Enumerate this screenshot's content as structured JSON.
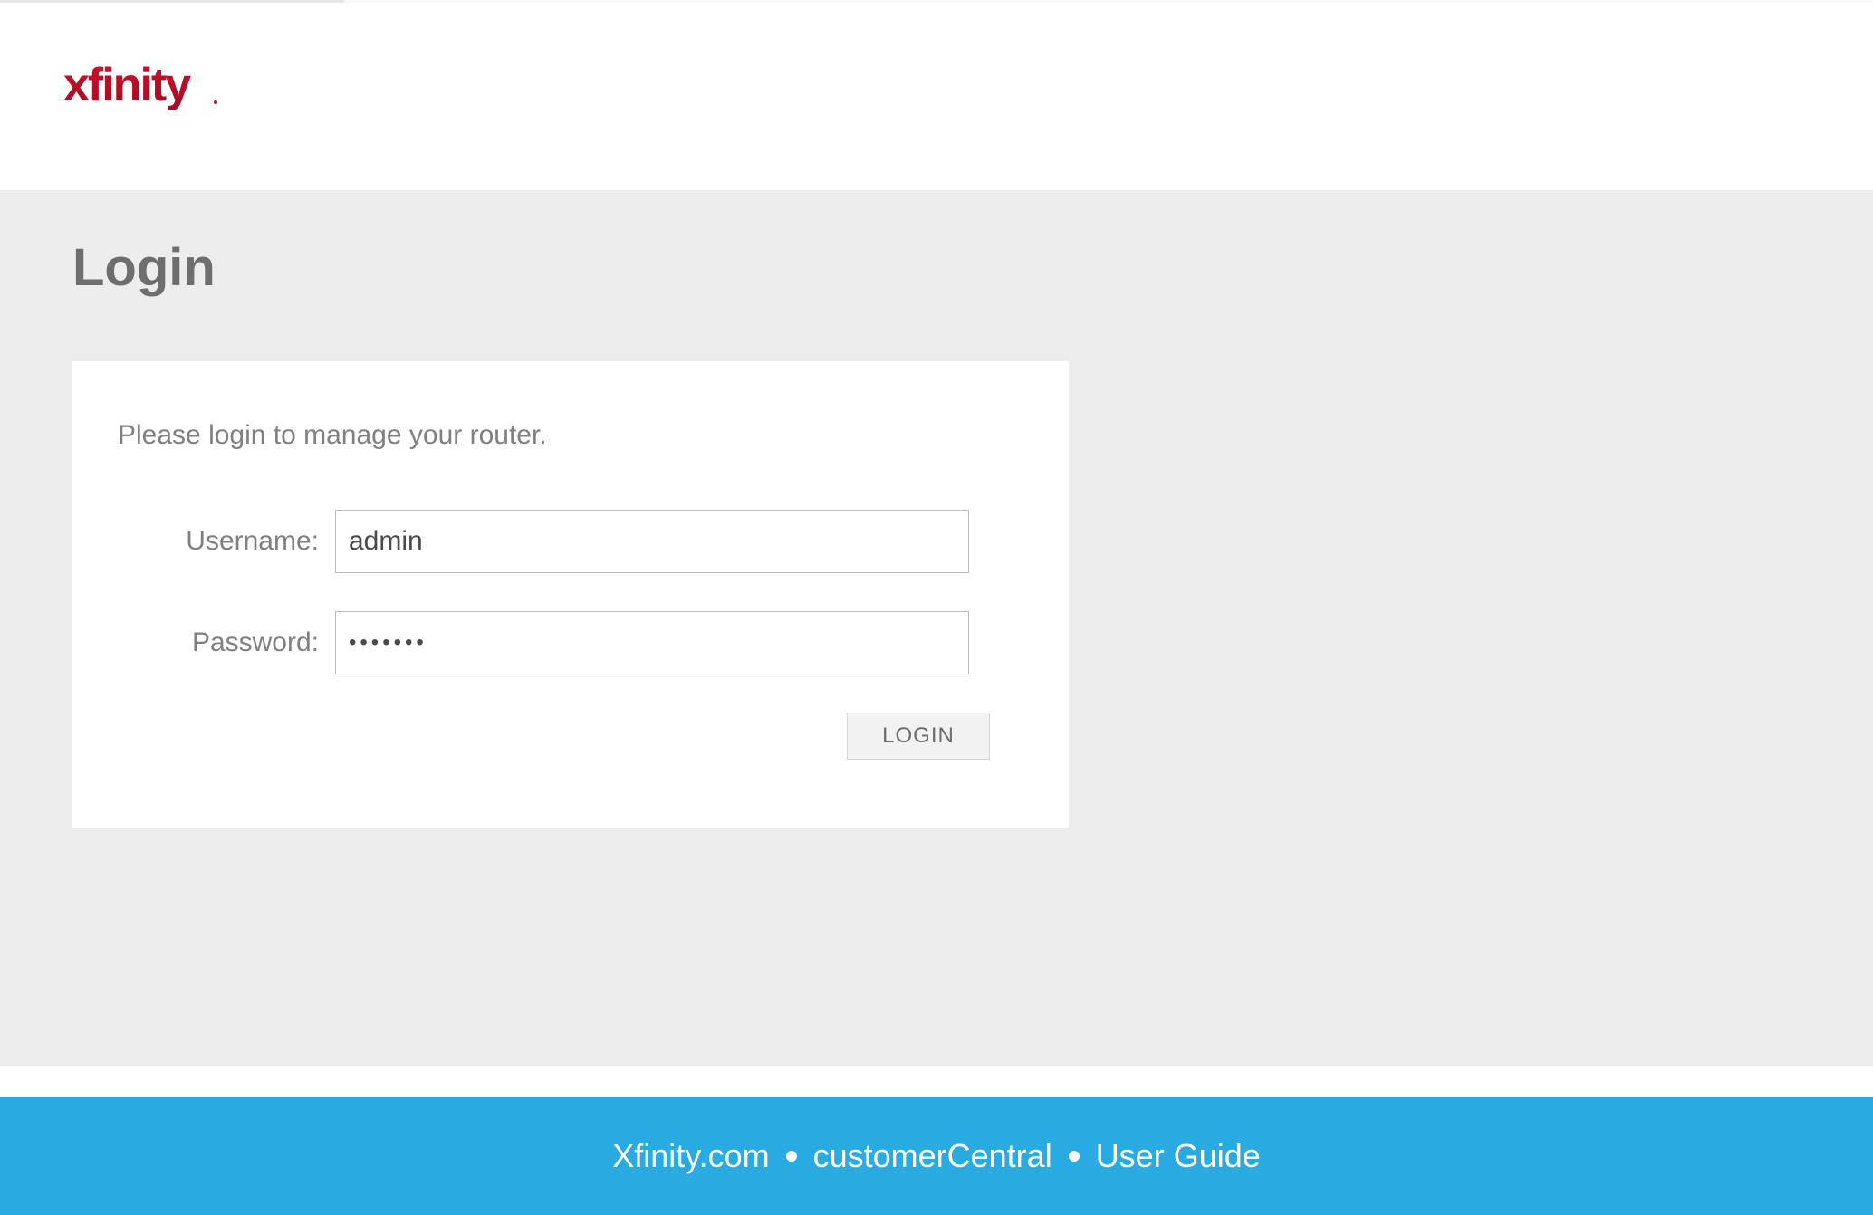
{
  "header": {
    "logo_text": "xfinity"
  },
  "page": {
    "title": "Login"
  },
  "login": {
    "instruction": "Please login to manage your router.",
    "username_label": "Username:",
    "username_value": "admin",
    "password_label": "Password:",
    "password_value": "•••••••",
    "button_label": "LOGIN"
  },
  "footer": {
    "links": [
      "Xfinity.com",
      "customerCentral",
      "User Guide"
    ]
  },
  "colors": {
    "brand_red": "#c8102e",
    "footer_blue": "#29abe2",
    "page_gray": "#ededed",
    "text_gray": "#6e6e6e"
  }
}
